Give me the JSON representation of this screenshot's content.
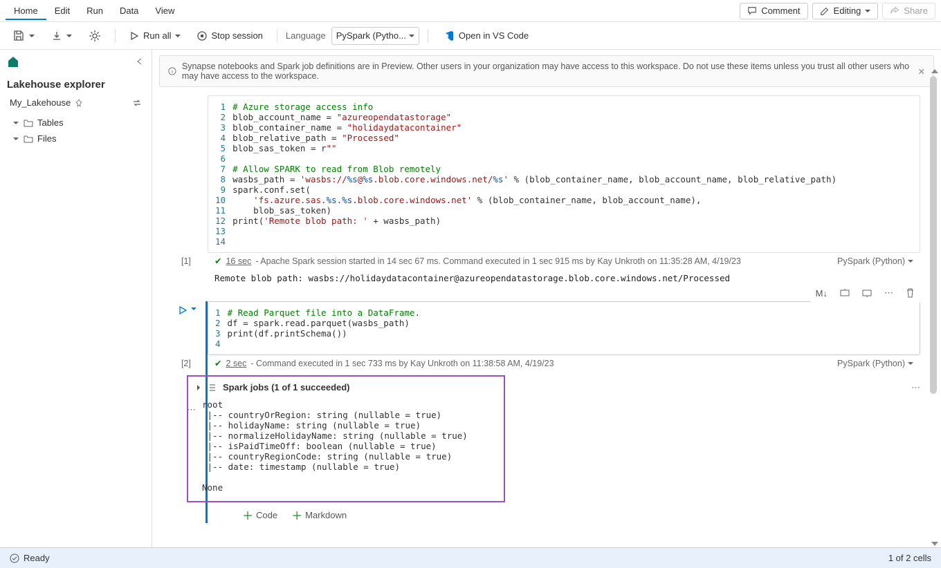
{
  "menu": {
    "home": "Home",
    "edit": "Edit",
    "run": "Run",
    "data": "Data",
    "view": "View",
    "comment": "Comment",
    "editing": "Editing",
    "share": "Share"
  },
  "toolbar": {
    "run_all": "Run all",
    "stop_session": "Stop session",
    "language_label": "Language",
    "language_value": "PySpark (Pytho...",
    "open_vscode": "Open in VS Code"
  },
  "info_banner": "Synapse notebooks and Spark job definitions are in Preview. Other users in your organization may have access to this workspace. Do not use these items unless you trust all other users who may have access to the workspace.",
  "sidebar": {
    "title": "Lakehouse explorer",
    "lakehouse_name": "My_Lakehouse",
    "tables": "Tables",
    "files": "Files"
  },
  "cell1": {
    "index": "[1]",
    "lines": [
      "1",
      "2",
      "3",
      "4",
      "5",
      "6",
      "7",
      "8",
      "9",
      "10",
      "11",
      "12",
      "13",
      "14"
    ],
    "code": {
      "l1": "# Azure storage access info",
      "l2a": "blob_account_name = ",
      "l2b": "\"azureopendatastorage\"",
      "l3a": "blob_container_name = ",
      "l3b": "\"holidaydatacontainer\"",
      "l4a": "blob_relative_path = ",
      "l4b": "\"Processed\"",
      "l5a": "blob_sas_token = r",
      "l5b": "\"\"",
      "l7": "# Allow SPARK to read from Blob remotely",
      "l8a": "wasbs_path = ",
      "l8b": "'wasbs://",
      "l8c": "%s",
      "l8d": "@",
      "l8e": "%s",
      "l8f": ".blob.core.windows.net/",
      "l8g": "%s",
      "l8h": "'",
      "l8i": " % (blob_container_name, blob_account_name, blob_relative_path)",
      "l9": "spark.conf.set(",
      "l10a": "    ",
      "l10b": "'fs.azure.sas.",
      "l10c": "%s",
      "l10d": ".",
      "l10e": "%s",
      "l10f": ".blob.core.windows.net'",
      "l10g": " % (blob_container_name, blob_account_name),",
      "l11": "    blob_sas_token)",
      "l12a": "print(",
      "l12b": "'Remote blob path: '",
      "l12c": " + wasbs_path)"
    },
    "status_time": "16 sec",
    "status_text": " - Apache Spark session started in 14 sec 67 ms. Command executed in 1 sec 915 ms by Kay Unkroth on 11:35:28 AM, 4/19/23",
    "lang": "PySpark (Python)",
    "output": "Remote blob path: wasbs://holidaydatacontainer@azureopendatastorage.blob.core.windows.net/Processed"
  },
  "cell2": {
    "index": "[2]",
    "lines": [
      "1",
      "2",
      "3",
      "4"
    ],
    "code": {
      "l1": "# Read Parquet file into a DataFrame.",
      "l2": "df = spark.read.parquet(wasbs_path)",
      "l3": "print(df.printSchema())"
    },
    "status_time": "2 sec",
    "status_text": " - Command executed in 1 sec 733 ms by Kay Unkroth on 11:38:58 AM, 4/19/23",
    "lang": "PySpark (Python)",
    "spark_jobs": "Spark jobs (1 of 1 succeeded)",
    "schema_output": "root\n |-- countryOrRegion: string (nullable = true)\n |-- holidayName: string (nullable = true)\n |-- normalizeHolidayName: string (nullable = true)\n |-- isPaidTimeOff: boolean (nullable = true)\n |-- countryRegionCode: string (nullable = true)\n |-- date: timestamp (nullable = true)\n\nNone"
  },
  "add": {
    "code": "Code",
    "markdown": "Markdown"
  },
  "statusbar": {
    "ready": "Ready",
    "cells": "1 of 2 cells"
  }
}
